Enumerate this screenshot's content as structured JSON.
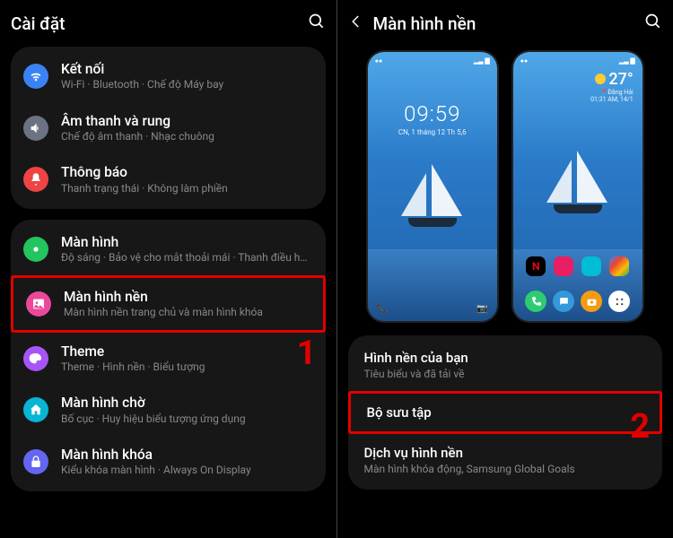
{
  "left": {
    "title": "Cài đặt",
    "groups": [
      {
        "items": [
          {
            "icon": "wifi",
            "iconbg": "bg-blue",
            "label": "Kết nối",
            "sub": "Wi-Fi · Bluetooth · Chế độ Máy bay"
          },
          {
            "icon": "volume",
            "iconbg": "bg-gray",
            "label": "Âm thanh và rung",
            "sub": "Chế độ âm thanh · Nhạc chuông"
          },
          {
            "icon": "bell",
            "iconbg": "bg-red",
            "label": "Thông báo",
            "sub": "Thanh trạng thái · Không làm phiền"
          }
        ]
      },
      {
        "items": [
          {
            "icon": "sun",
            "iconbg": "bg-green",
            "label": "Màn hình",
            "sub": "Độ sáng · Bảo vệ cho mắt thoải mái · Thanh điều hướng"
          },
          {
            "icon": "image",
            "iconbg": "bg-pink",
            "label": "Màn hình nền",
            "sub": "Màn hình nền trang chủ và màn hình khóa",
            "highlight": true
          },
          {
            "icon": "palette",
            "iconbg": "bg-purple",
            "label": "Theme",
            "sub": "Theme · Hình nền · Biểu tượng"
          },
          {
            "icon": "home",
            "iconbg": "bg-teal",
            "label": "Màn hình chờ",
            "sub": "Bố cục · Huy hiệu biểu tượng ứng dụng"
          },
          {
            "icon": "lock",
            "iconbg": "bg-indigo",
            "label": "Màn hình khóa",
            "sub": "Kiểu khóa màn hình · Always On Display"
          }
        ]
      }
    ],
    "annotation": "1"
  },
  "right": {
    "title": "Màn hình nền",
    "lock_preview": {
      "time": "09:59",
      "date": "CN, 1 tháng 12 Th 5,6"
    },
    "home_preview": {
      "temp": "27°",
      "location": "Đằng Hải",
      "timestamp": "01:31 AM, 14/1"
    },
    "items": [
      {
        "label": "Hình nền của bạn",
        "sub": "Tiêu biểu và đã tải về"
      },
      {
        "label": "Bộ sưu tập",
        "sub": "",
        "highlight": true
      },
      {
        "label": "Dịch vụ hình nền",
        "sub": "Màn hình khóa động, Samsung Global Goals"
      }
    ],
    "annotation": "2"
  }
}
